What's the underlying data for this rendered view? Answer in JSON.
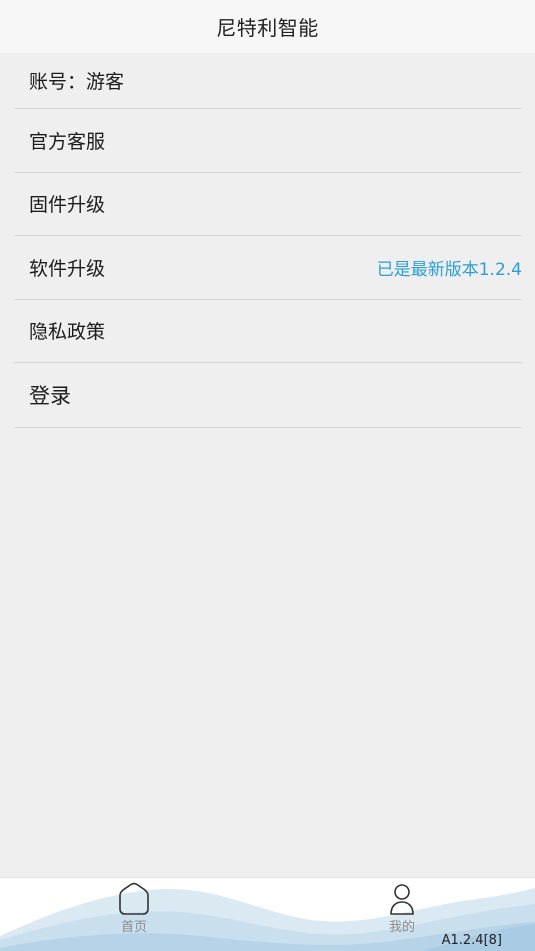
{
  "header": {
    "title": "尼特利智能"
  },
  "menu": {
    "items": [
      {
        "label": "账号：游客",
        "value": ""
      },
      {
        "label": "官方客服",
        "value": ""
      },
      {
        "label": "固件升级",
        "value": ""
      },
      {
        "label": "软件升级",
        "value": "已是最新版本1.2.4"
      },
      {
        "label": "隐私政策",
        "value": ""
      },
      {
        "label": "登录",
        "value": ""
      }
    ]
  },
  "tabbar": {
    "tabs": [
      {
        "label": "首页",
        "icon": "home-icon"
      },
      {
        "label": "我的",
        "icon": "user-icon"
      }
    ],
    "version": "A1.2.4[8]"
  },
  "colors": {
    "accent": "#2b9fd8",
    "background": "#efefef",
    "header": "#f7f7f7"
  }
}
